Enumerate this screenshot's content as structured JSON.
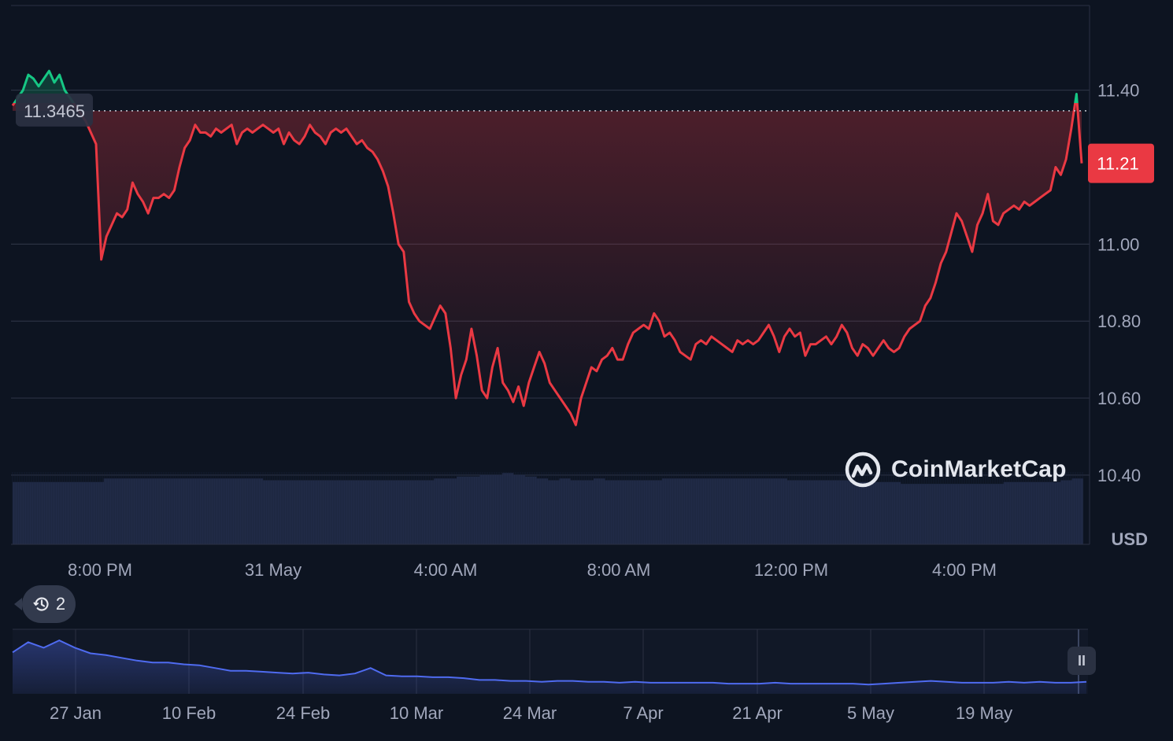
{
  "chart_data": {
    "type": "line",
    "currency_label": "USD",
    "y_ticks": [
      "11.40",
      "11.00",
      "10.80",
      "10.60",
      "10.40"
    ],
    "y_tick_values": [
      11.4,
      11.0,
      10.8,
      10.6,
      10.4
    ],
    "ylim": [
      10.22,
      11.62
    ],
    "x_ticks": [
      "8:00 PM",
      "31 May",
      "4:00 AM",
      "8:00 AM",
      "12:00 PM",
      "4:00 PM"
    ],
    "reference_price": 11.3465,
    "reference_label": "11.3465",
    "current_price": 11.21,
    "current_label": "11.21",
    "colors": {
      "up": "#16c784",
      "down": "#ea3943",
      "navigator": "#4f6bf0",
      "current_price_badge": "#ea3943",
      "grid": "#2a3142"
    },
    "series": [
      {
        "values": [
          11.36,
          11.38,
          11.4,
          11.44,
          11.43,
          11.41,
          11.43,
          11.45,
          11.42,
          11.44,
          11.4,
          11.38,
          11.36,
          11.34,
          11.32,
          11.29,
          11.26,
          10.96,
          11.02,
          11.05,
          11.08,
          11.07,
          11.09,
          11.16,
          11.13,
          11.11,
          11.08,
          11.12,
          11.12,
          11.13,
          11.12,
          11.14,
          11.2,
          11.25,
          11.27,
          11.31,
          11.29,
          11.29,
          11.28,
          11.3,
          11.29,
          11.3,
          11.31,
          11.26,
          11.29,
          11.3,
          11.29,
          11.3,
          11.31,
          11.3,
          11.29,
          11.3,
          11.26,
          11.29,
          11.27,
          11.26,
          11.28,
          11.31,
          11.29,
          11.28,
          11.26,
          11.29,
          11.3,
          11.29,
          11.3,
          11.28,
          11.26,
          11.27,
          11.25,
          11.24,
          11.22,
          11.19,
          11.15,
          11.08,
          11.0,
          10.98,
          10.85,
          10.82,
          10.8,
          10.79,
          10.78,
          10.81,
          10.84,
          10.82,
          10.73,
          10.6,
          10.66,
          10.7,
          10.78,
          10.71,
          10.62,
          10.6,
          10.68,
          10.73,
          10.64,
          10.62,
          10.59,
          10.63,
          10.58,
          10.64,
          10.68,
          10.72,
          10.69,
          10.64,
          10.62,
          10.6,
          10.58,
          10.56,
          10.53,
          10.6,
          10.64,
          10.68,
          10.67,
          10.7,
          10.71,
          10.73,
          10.7,
          10.7,
          10.74,
          10.77,
          10.78,
          10.79,
          10.78,
          10.82,
          10.8,
          10.76,
          10.77,
          10.75,
          10.72,
          10.71,
          10.7,
          10.74,
          10.75,
          10.74,
          10.76,
          10.75,
          10.74,
          10.73,
          10.72,
          10.75,
          10.74,
          10.75,
          10.74,
          10.75,
          10.77,
          10.79,
          10.76,
          10.72,
          10.76,
          10.78,
          10.76,
          10.77,
          10.71,
          10.74,
          10.74,
          10.75,
          10.76,
          10.74,
          10.76,
          10.79,
          10.77,
          10.73,
          10.71,
          10.74,
          10.73,
          10.71,
          10.73,
          10.75,
          10.73,
          10.72,
          10.73,
          10.76,
          10.78,
          10.79,
          10.8,
          10.84,
          10.86,
          10.9,
          10.95,
          10.98,
          11.03,
          11.08,
          11.06,
          11.02,
          10.98,
          11.05,
          11.08,
          11.13,
          11.06,
          11.05,
          11.08,
          11.09,
          11.1,
          11.09,
          11.11,
          11.1,
          11.11,
          11.12,
          11.13,
          11.14,
          11.2,
          11.18,
          11.22,
          11.3,
          11.39,
          11.21
        ]
      }
    ],
    "volume": {
      "values": [
        0.34,
        0.34,
        0.34,
        0.34,
        0.34,
        0.34,
        0.34,
        0.34,
        0.36,
        0.36,
        0.36,
        0.36,
        0.36,
        0.36,
        0.36,
        0.36,
        0.36,
        0.36,
        0.36,
        0.36,
        0.36,
        0.36,
        0.35,
        0.35,
        0.35,
        0.35,
        0.35,
        0.35,
        0.35,
        0.35,
        0.35,
        0.35,
        0.35,
        0.35,
        0.35,
        0.35,
        0.35,
        0.36,
        0.36,
        0.37,
        0.37,
        0.38,
        0.38,
        0.39,
        0.38,
        0.37,
        0.36,
        0.35,
        0.36,
        0.35,
        0.35,
        0.36,
        0.35,
        0.35,
        0.35,
        0.35,
        0.35,
        0.36,
        0.36,
        0.36,
        0.36,
        0.36,
        0.36,
        0.36,
        0.36,
        0.36,
        0.36,
        0.36,
        0.35,
        0.35,
        0.35,
        0.35,
        0.35,
        0.35,
        0.34,
        0.34,
        0.34,
        0.34,
        0.33,
        0.33,
        0.33,
        0.33,
        0.33,
        0.33,
        0.33,
        0.33,
        0.33,
        0.34,
        0.34,
        0.34,
        0.34,
        0.34,
        0.35,
        0.36
      ]
    },
    "navigator": {
      "x_ticks": [
        "27 Jan",
        "10 Feb",
        "24 Feb",
        "10 Mar",
        "24 Mar",
        "7 Apr",
        "21 Apr",
        "5 May",
        "19 May"
      ],
      "values": [
        18.5,
        19.6,
        19.0,
        19.8,
        19.0,
        18.4,
        18.2,
        17.9,
        17.6,
        17.4,
        17.4,
        17.2,
        17.1,
        16.8,
        16.5,
        16.5,
        16.4,
        16.3,
        16.2,
        16.3,
        16.1,
        16.0,
        16.2,
        16.8,
        16.0,
        15.9,
        15.9,
        15.8,
        15.8,
        15.7,
        15.5,
        15.5,
        15.4,
        15.4,
        15.3,
        15.4,
        15.4,
        15.3,
        15.3,
        15.2,
        15.3,
        15.2,
        15.2,
        15.2,
        15.2,
        15.2,
        15.1,
        15.1,
        15.1,
        15.2,
        15.1,
        15.1,
        15.1,
        15.1,
        15.1,
        15.0,
        15.1,
        15.2,
        15.3,
        15.4,
        15.3,
        15.2,
        15.2,
        15.2,
        15.3,
        15.2,
        15.3,
        15.2,
        15.2,
        15.3
      ]
    }
  },
  "controls": {
    "history_count": "2",
    "pause_symbol": "II",
    "brand_name": "CoinMarketCap"
  }
}
